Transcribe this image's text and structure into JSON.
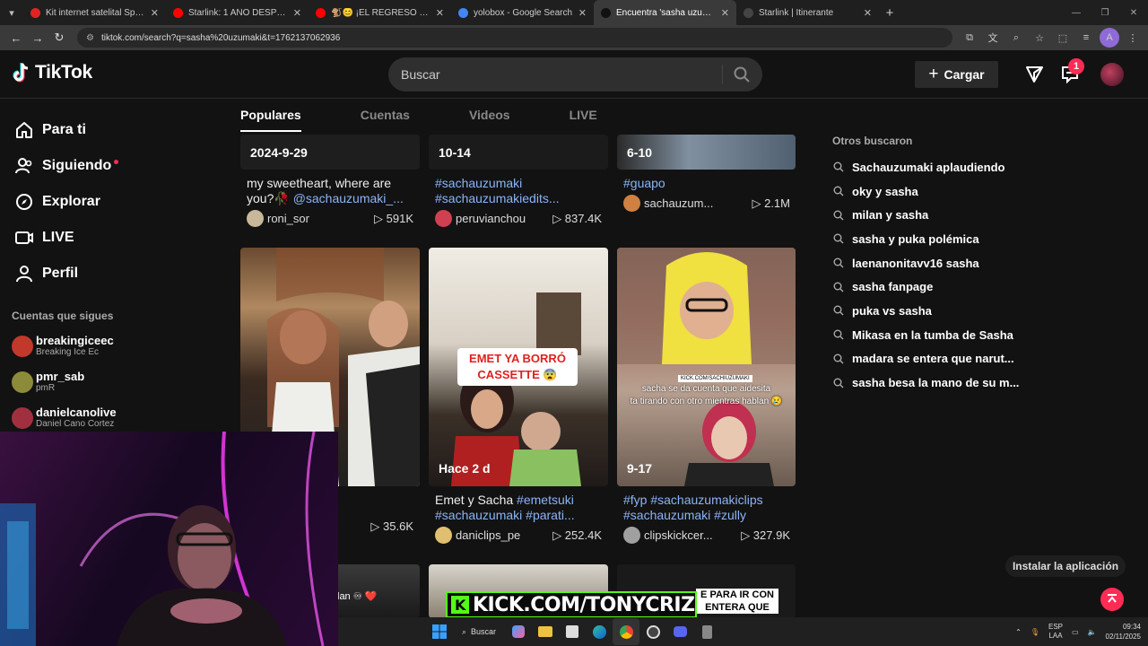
{
  "browser": {
    "tabs": [
      {
        "title": "Kit internet satelital SpaceX V4",
        "color": "#e02424",
        "active": false
      },
      {
        "title": "Starlink: 1 AÑO DESPUÉS ¿Qué",
        "color": "#ff0000",
        "active": false
      },
      {
        "title": "🐒😊 ¡EL REGRESO de los FUN",
        "color": "#ff0000",
        "active": false
      },
      {
        "title": "yolobox - Google Search",
        "color": "#4285f4",
        "active": false
      },
      {
        "title": "Encuentra 'sasha uzumaki' en T",
        "color": "#111111",
        "active": true
      },
      {
        "title": "Starlink | Itinerante",
        "color": "#444444",
        "active": false
      }
    ],
    "url": "tiktok.com/search?q=sasha%20uzumaki&t=1762137062936"
  },
  "header": {
    "logo": "TikTok",
    "search_placeholder": "Buscar",
    "upload_label": "Cargar",
    "inbox_badge": "1"
  },
  "sidebar": {
    "items": [
      {
        "label": "Para ti",
        "icon": "home-icon"
      },
      {
        "label": "Siguiendo",
        "icon": "following-icon"
      },
      {
        "label": "Explorar",
        "icon": "compass-icon"
      },
      {
        "label": "LIVE",
        "icon": "live-icon"
      },
      {
        "label": "Perfil",
        "icon": "profile-icon"
      }
    ],
    "following_title": "Cuentas que sigues",
    "following": [
      {
        "name": "breakingiceec",
        "sub": "Breaking Ice Ec",
        "color": "#c0392b"
      },
      {
        "name": "pmr_sab",
        "sub": "pmR",
        "color": "#8b8b3a"
      },
      {
        "name": "danielcanolive",
        "sub": "Daniel Cano Cortez",
        "color": "#a03040"
      }
    ]
  },
  "search_tabs": [
    "Populares",
    "Cuentas",
    "Videos",
    "LIVE"
  ],
  "videos_top": [
    {
      "label": "2024-9-29",
      "caption": "my sweetheart, where are you?🥀",
      "tag": "@sachauzumaki_...",
      "user": "roni_sor",
      "views": "591K",
      "ucolor": "#c8b89a"
    },
    {
      "label": "10-14",
      "tag1": "#sachauzumaki",
      "tag2": "#sachauzumakiedits...",
      "user": "peruvianchou",
      "views": "837.4K",
      "ucolor": "#d04050"
    },
    {
      "label": "6-10",
      "tag": "#guapo",
      "user": "sachauzum...",
      "views": "2.1M",
      "ucolor": "#d08040"
    }
  ],
  "videos_mid": [
    {
      "user": "",
      "views": "35.6K"
    },
    {
      "label": "Hace 2 d",
      "overlay1": "EMET YA",
      "overlay2": "BORRÓ",
      "overlay3": "CASSETTE",
      "caption": "Emet y Sacha",
      "tag1": "#emetsuki",
      "tag2": "#sachauzumaki #parati...",
      "user": "daniclips_pe",
      "views": "252.4K",
      "ucolor": "#e0c070"
    },
    {
      "label": "9-17",
      "overlay_small": "KICK.COM/SACHIUZUMAKI",
      "overlay1": "sacha se da cuenta que aidesita",
      "overlay2": "ta tirando con otro mientras hablan 😢",
      "tag1": "#fyp #sachauzumakiclips",
      "tag2": "#sachauzumaki #zully",
      "user": "clipskickcer...",
      "views": "327.9K",
      "ucolor": "#a0a0a0"
    }
  ],
  "videos_bottom": [
    {
      "text": "lan ♾ ❤️"
    },
    {
      "text": ""
    },
    {
      "text1": "E PARA IR CON",
      "text2": "ENTERA QUE"
    }
  ],
  "related": {
    "title": "Otros buscaron",
    "items": [
      "Sachauzumaki aplaudiendo",
      "oky y sasha",
      "milan y sasha",
      "sasha y puka polémica",
      "laenanonitavv16 sasha",
      "sasha fanpage",
      "puka vs sasha",
      "Mikasa en la tumba de Sasha",
      "madara se entera que narut...",
      "sasha besa la mano de su m..."
    ]
  },
  "install_label": "Instalar la aplicación",
  "overlay_kick": "KICK.COM/TONYCRIZ",
  "taskbar": {
    "search": "Buscar",
    "lang1": "ESP",
    "lang2": "LAA",
    "time": "09:34",
    "date": "02/11/2025"
  }
}
